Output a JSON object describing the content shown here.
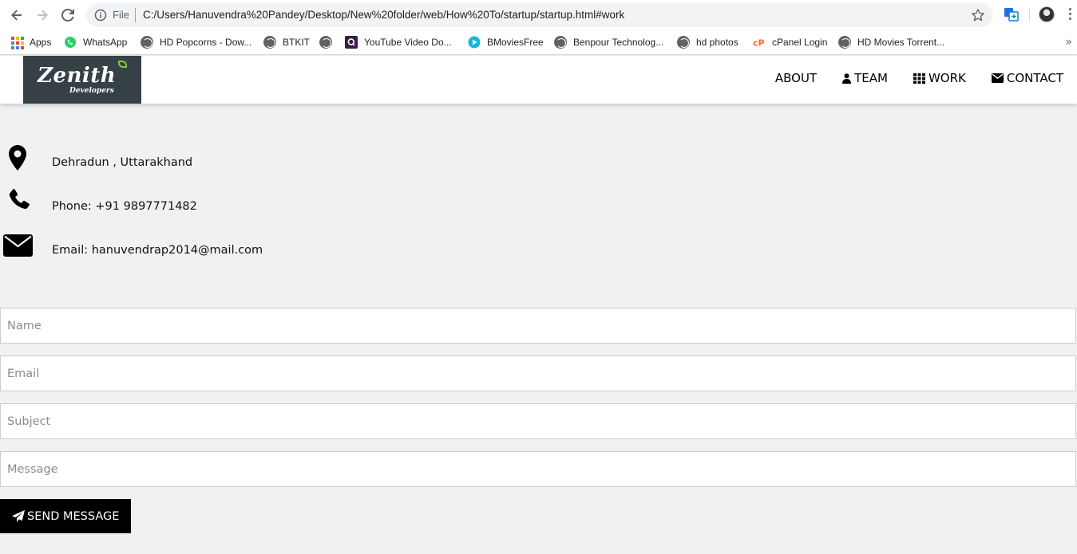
{
  "browser": {
    "scheme_label": "File",
    "url": "C:/Users/Hanuvendra%20Pandey/Desktop/New%20folder/web/How%20To/startup/startup.html#work"
  },
  "bookmarks": [
    {
      "label": "Apps",
      "icon": "apps-grid-icon"
    },
    {
      "label": "WhatsApp",
      "icon": "whatsapp-icon"
    },
    {
      "label": "HD Popcorns - Dow...",
      "icon": "globe-icon"
    },
    {
      "label": "BTKIT",
      "icon": "globe-icon"
    },
    {
      "label": "",
      "icon": "globe-icon"
    },
    {
      "label": "YouTube Video Do...",
      "icon": "q-icon"
    },
    {
      "label": "BMoviesFree",
      "icon": "play-icon"
    },
    {
      "label": "Benpour Technolog...",
      "icon": "globe-icon"
    },
    {
      "label": "hd photos",
      "icon": "globe-icon"
    },
    {
      "label": "cPanel Login",
      "icon": "cpanel-icon"
    },
    {
      "label": "HD Movies Torrent...",
      "icon": "globe-icon"
    }
  ],
  "site": {
    "logo": {
      "main": "Zenith",
      "sub": "Developers"
    },
    "menu": [
      {
        "label": "ABOUT",
        "icon": ""
      },
      {
        "label": "TEAM",
        "icon": "user-icon"
      },
      {
        "label": "WORK",
        "icon": "grid-icon"
      },
      {
        "label": "CONTACT",
        "icon": "envelope-icon"
      }
    ]
  },
  "contact": {
    "location": "Dehradun , Uttarakhand",
    "phone": "Phone: +91 9897771482",
    "email": "Email: hanuvendrap2014@mail.com"
  },
  "form": {
    "name_placeholder": "Name",
    "email_placeholder": "Email",
    "subject_placeholder": "Subject",
    "message_placeholder": "Message",
    "submit_label": "SEND MESSAGE"
  },
  "colors": {
    "page_background": "#f1f1f1",
    "logo_background": "#354047",
    "button_background": "#000000"
  }
}
